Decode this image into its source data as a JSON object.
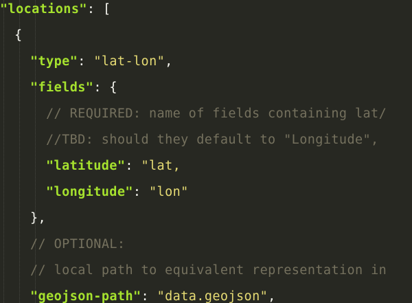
{
  "theme": {
    "background": "#272822",
    "key_color": "#a6e22e",
    "string_color": "#e6db74",
    "comment_color": "#75715e",
    "text_color": "#f8f8f2"
  },
  "lines": [
    {
      "indent": 0,
      "tokens": [
        {
          "type": "key",
          "text": "\"locations\""
        },
        {
          "type": "punct",
          "text": ": ["
        }
      ]
    },
    {
      "indent": 1,
      "tokens": [
        {
          "type": "punct",
          "text": "{"
        }
      ]
    },
    {
      "indent": 2,
      "tokens": [
        {
          "type": "key",
          "text": "\"type\""
        },
        {
          "type": "punct",
          "text": ": "
        },
        {
          "type": "value",
          "text": "\"lat-lon\""
        },
        {
          "type": "punct",
          "text": ","
        }
      ]
    },
    {
      "indent": 2,
      "tokens": [
        {
          "type": "key",
          "text": "\"fields\""
        },
        {
          "type": "punct",
          "text": ": {"
        }
      ]
    },
    {
      "indent": 3,
      "tokens": [
        {
          "type": "comment",
          "text": "// REQUIRED: name of fields containing lat/"
        }
      ]
    },
    {
      "indent": 3,
      "tokens": [
        {
          "type": "comment",
          "text": "//TBD: should they default to \"Longitude\","
        }
      ]
    },
    {
      "indent": 3,
      "tokens": [
        {
          "type": "key",
          "text": "\"latitude\""
        },
        {
          "type": "punct",
          "text": ": "
        },
        {
          "type": "value",
          "text": "\"lat,"
        }
      ]
    },
    {
      "indent": 3,
      "tokens": [
        {
          "type": "key",
          "text": "\"longitude\""
        },
        {
          "type": "punct",
          "text": ": "
        },
        {
          "type": "value",
          "text": "\"lon\""
        }
      ]
    },
    {
      "indent": 2,
      "tokens": [
        {
          "type": "punct",
          "text": "},"
        }
      ]
    },
    {
      "indent": 2,
      "tokens": [
        {
          "type": "comment",
          "text": "// OPTIONAL:"
        }
      ]
    },
    {
      "indent": 2,
      "tokens": [
        {
          "type": "comment",
          "text": "// local path to equivalent representation in"
        }
      ]
    },
    {
      "indent": 2,
      "tokens": [
        {
          "type": "key",
          "text": "\"geojson-path\""
        },
        {
          "type": "punct",
          "text": ": "
        },
        {
          "type": "value",
          "text": "\"data.geojson\""
        },
        {
          "type": "punct",
          "text": ","
        }
      ]
    }
  ]
}
